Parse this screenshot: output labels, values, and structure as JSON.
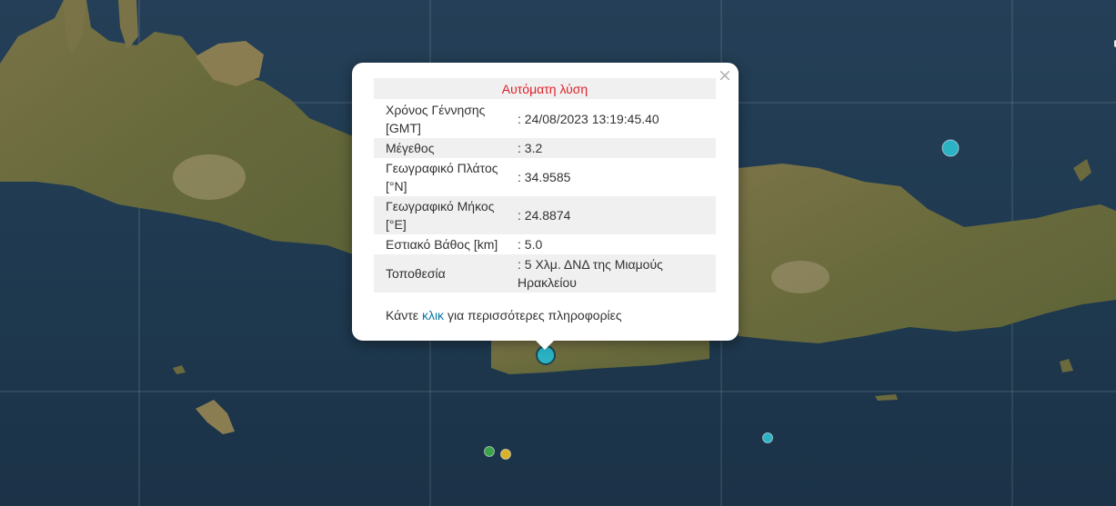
{
  "popup": {
    "title": "Αυτόματη λύση",
    "rows": [
      {
        "label": "Χρόνος Γέννησης [GMT]",
        "value": ": 24/08/2023 13:19:45.40"
      },
      {
        "label": "Μέγεθος",
        "value": ": 3.2"
      },
      {
        "label": "Γεωγραφικό Πλάτος [°N]",
        "value": ": 34.9585"
      },
      {
        "label": "Γεωγραφικό Μήκος [°E]",
        "value": ": 24.8874"
      },
      {
        "label": "Εστιακό Βάθος [km]",
        "value": ": 5.0"
      },
      {
        "label": "Τοποθεσία",
        "value": ": 5 Χλμ. ΔΝΔ της Μιαμούς Ηρακλείου"
      }
    ],
    "more_prefix": "Κάντε",
    "more_link": "κλικ",
    "more_suffix": "για περισσότερες πληροφορίες",
    "close_glyph": "×"
  },
  "markers": [
    {
      "name": "selected",
      "color": "#2bb3c4"
    },
    {
      "name": "northeast",
      "color": "#2bb3c4"
    },
    {
      "name": "southeast",
      "color": "#2bb3c4"
    },
    {
      "name": "south-green",
      "color": "#3aa34a"
    },
    {
      "name": "south-yellow",
      "color": "#d9b22a"
    }
  ],
  "colors": {
    "sea": "#1f3a52",
    "land": "#6b6a3e",
    "accent_title": "#e0202a",
    "link": "#0a76a6"
  }
}
